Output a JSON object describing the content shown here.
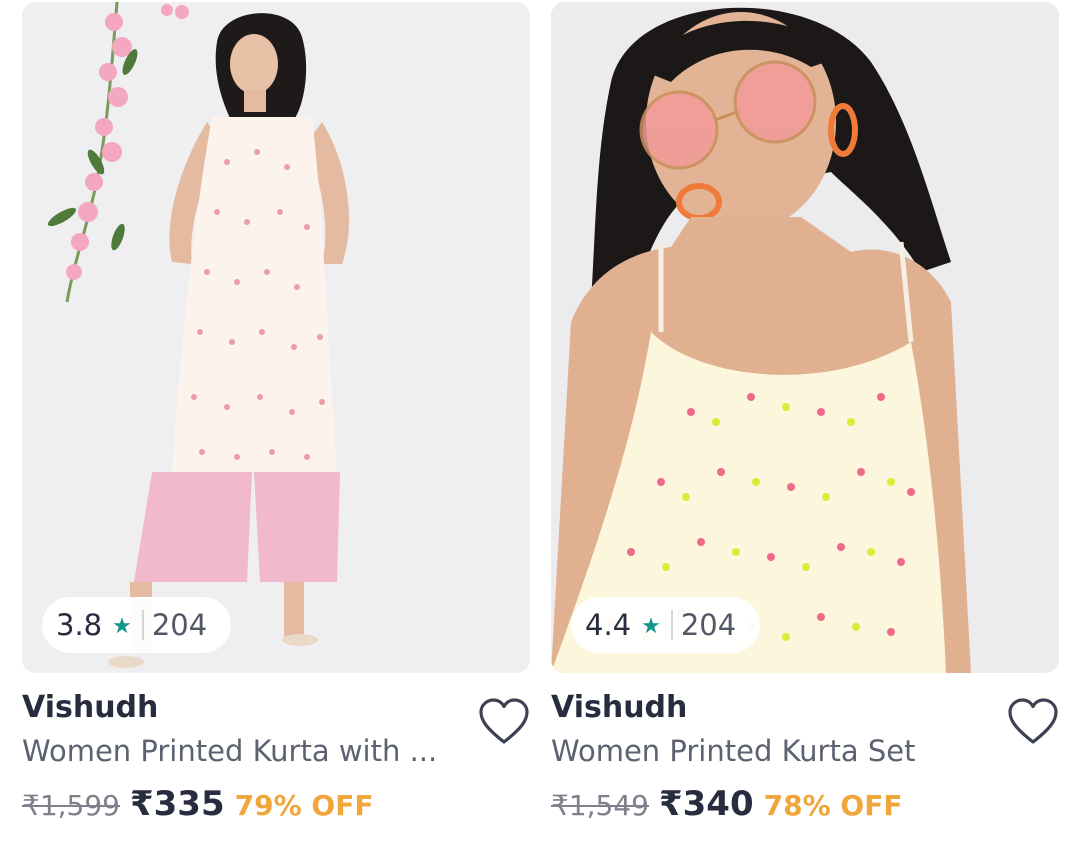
{
  "colors": {
    "star": "#14958f",
    "discount": "#f1a63b",
    "brand_text": "#282c3f",
    "muted_text": "#7e818c"
  },
  "products": [
    {
      "image_description_icon": "product-photo-kurta-with-palazzo",
      "rating": "3.8",
      "star_icon": "star-icon",
      "rating_count": "204",
      "brand": "Vishudh",
      "title": "Women Printed Kurta with ...",
      "mrp": "₹1,599",
      "price": "₹335",
      "discount": "79% OFF",
      "wishlist_icon": "heart-outline-icon"
    },
    {
      "image_description_icon": "product-photo-kurta-set",
      "rating": "4.4",
      "star_icon": "star-icon",
      "rating_count": "204",
      "brand": "Vishudh",
      "title": "Women Printed Kurta Set",
      "mrp": "₹1,549",
      "price": "₹340",
      "discount": "78% OFF",
      "wishlist_icon": "heart-outline-icon"
    }
  ]
}
